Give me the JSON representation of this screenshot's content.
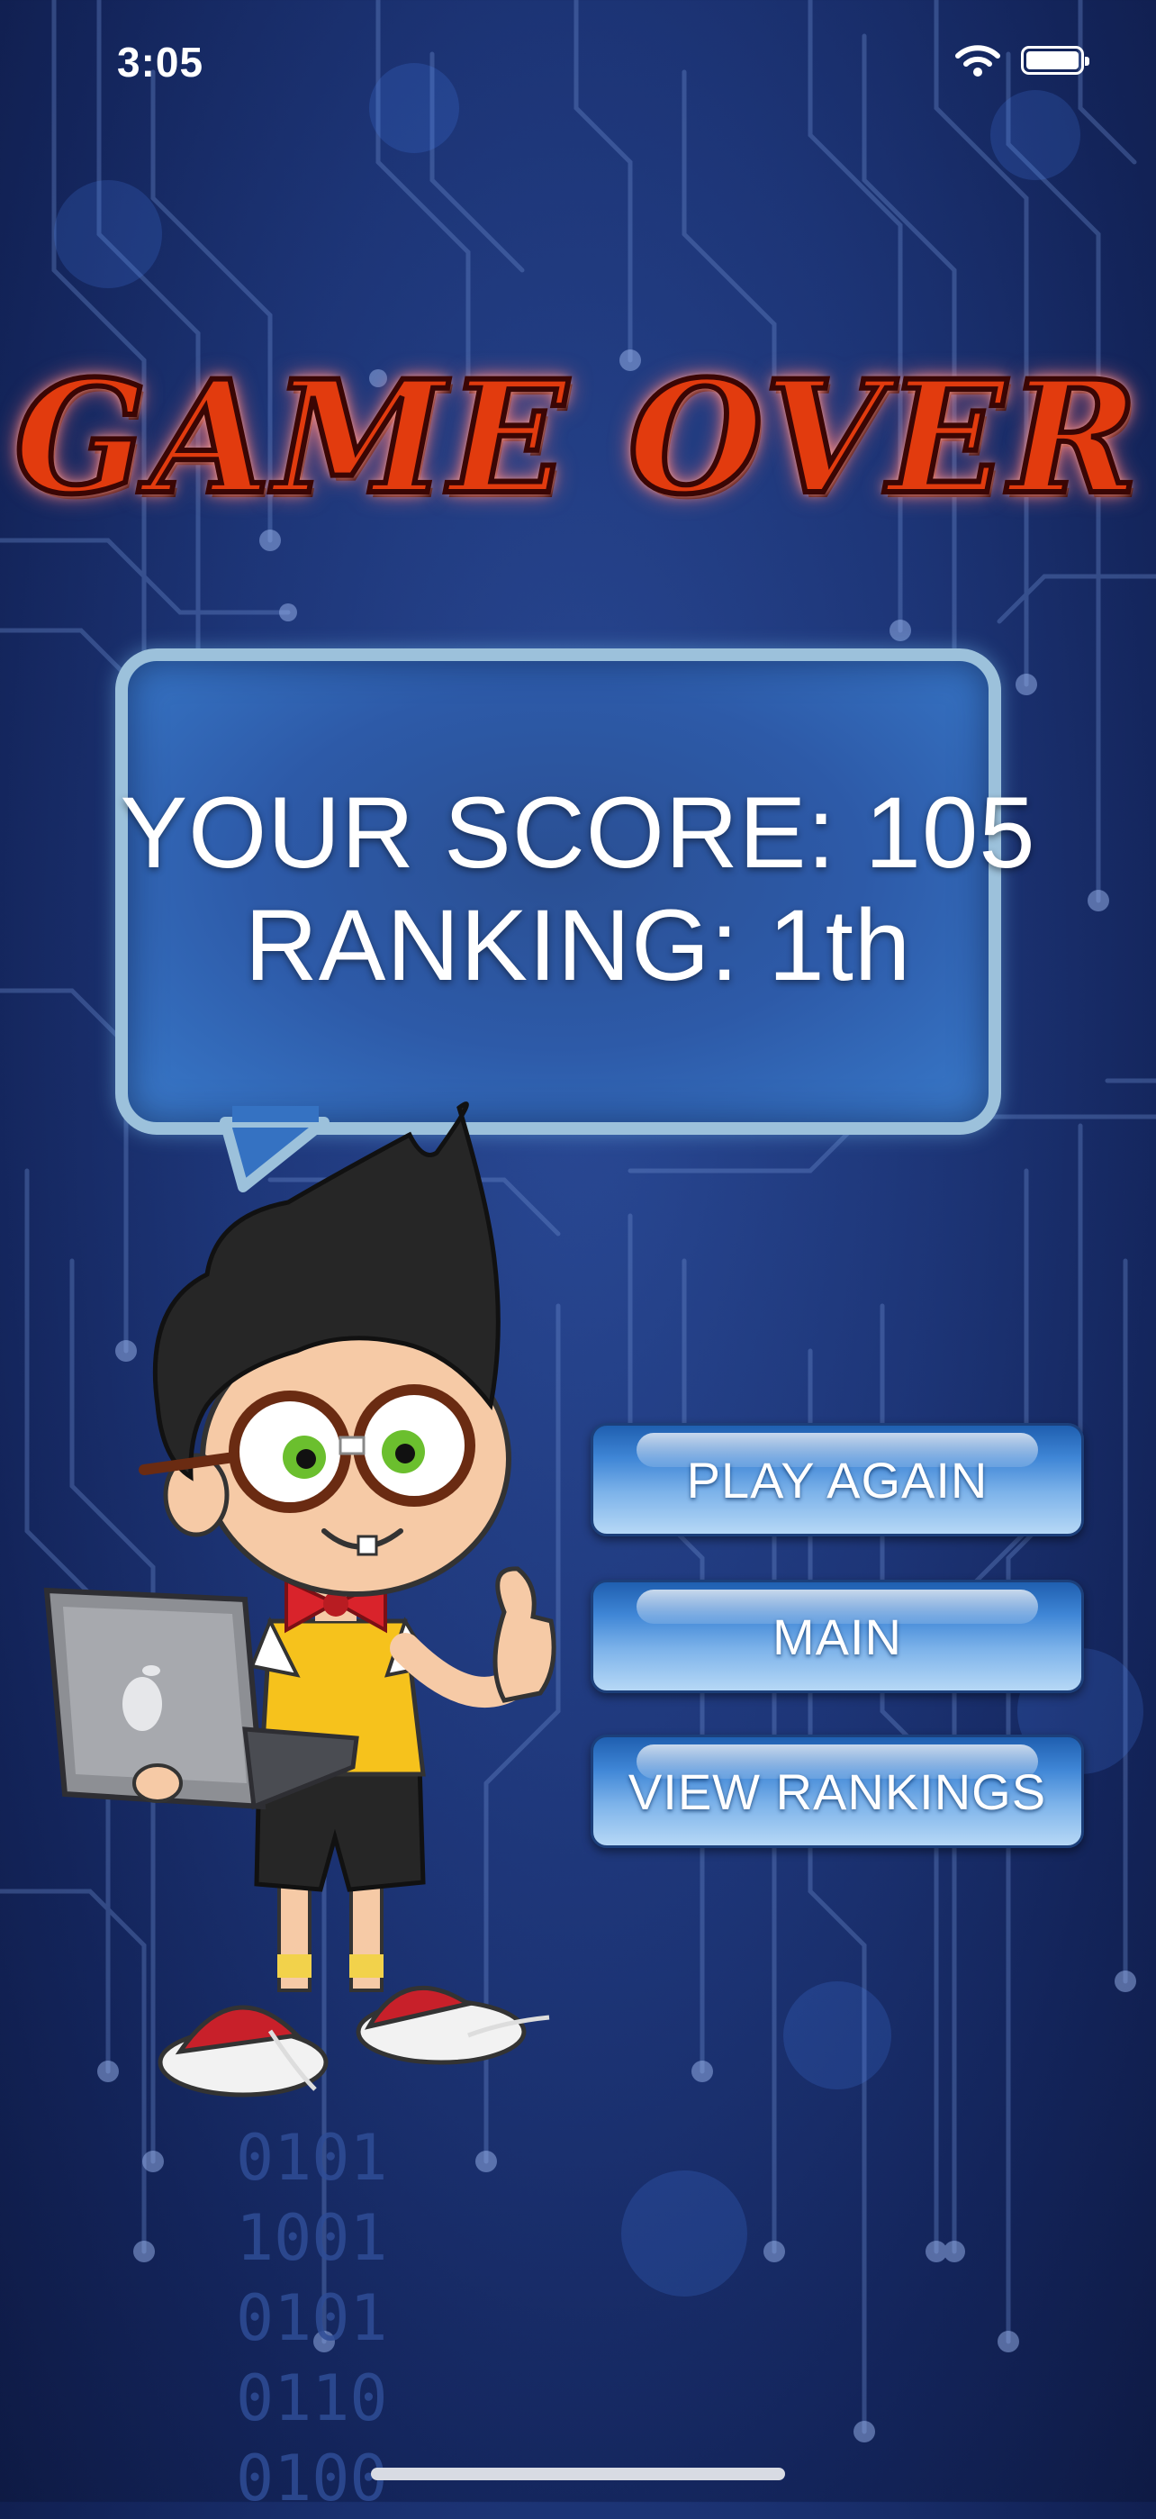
{
  "status_bar": {
    "time": "3:05"
  },
  "title": "GAME OVER",
  "score": {
    "line1": "YOUR SCORE: 105",
    "line2": "RANKING: 1th"
  },
  "buttons": {
    "play_again": "PLAY AGAIN",
    "main": "MAIN",
    "view_rankings": "VIEW RANKINGS"
  },
  "binary_lines": [
    "0101",
    "1001",
    "0101",
    "0110",
    "0100"
  ],
  "colors": {
    "background": "#1d3577",
    "title": "#e23b0e",
    "bubble_border": "#9cc1db",
    "button": "#3f86d6"
  }
}
